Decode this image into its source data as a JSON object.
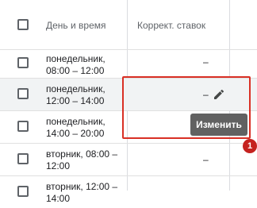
{
  "header": {
    "col_datetime": "День и время",
    "col_adjust": "Коррект. ставок"
  },
  "rows": [
    {
      "day": "понедельник, 08:00 – 12:00",
      "adjust": "–"
    },
    {
      "day": "понедельник, 12:00 – 14:00",
      "adjust": "–"
    },
    {
      "day": "понедельник, 14:00 – 20:00",
      "adjust": ""
    },
    {
      "day": "вторник, 08:00 – 12:00",
      "adjust": "–"
    },
    {
      "day": "вторник, 12:00 – 14:00",
      "adjust": ""
    }
  ],
  "tooltip": {
    "text": "Изменить"
  },
  "annotation": {
    "badge": "1",
    "color": "#d93025"
  },
  "icons": {
    "edit": "pencil-icon"
  }
}
